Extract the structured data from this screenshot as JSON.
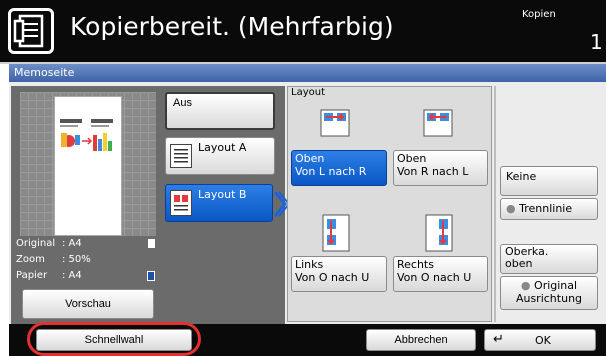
{
  "header": {
    "title": "Kopierbereit. (Mehrfarbig)",
    "copies_label": "Kopien",
    "copies_count": "1"
  },
  "dialog": {
    "title": "Memoseite"
  },
  "info": {
    "original_label": "Original",
    "original_value": ": A4",
    "zoom_label": "Zoom",
    "zoom_value": ": 50%",
    "paper_label": "Papier",
    "paper_value": ": A4"
  },
  "preview_button": "Vorschau",
  "modes": {
    "aus": "Aus",
    "layout_a": "Layout A",
    "layout_b": "Layout B"
  },
  "layout": {
    "title": "Layout",
    "oben_l_r_1": "Oben",
    "oben_l_r_2": "Von L nach R",
    "oben_r_l_1": "Oben",
    "oben_r_l_2": "Von R nach L",
    "links_1": "Links",
    "links_2": "Von O nach U",
    "rechts_1": "Rechts",
    "rechts_2": "Von O nach U"
  },
  "border": {
    "keine": "Keine",
    "trennlinie": "Trennlinie"
  },
  "orientation": {
    "oberkante_1": "Oberka.",
    "oberkante_2": "oben",
    "original_1": "Original",
    "original_2": "Ausrichtung"
  },
  "bottom": {
    "schnellwahl": "Schnellwahl",
    "abbrechen": "Abbrechen",
    "ok": "OK"
  },
  "colors": {
    "selected_blue": "#0a57c6",
    "highlight_red": "#e53030"
  }
}
